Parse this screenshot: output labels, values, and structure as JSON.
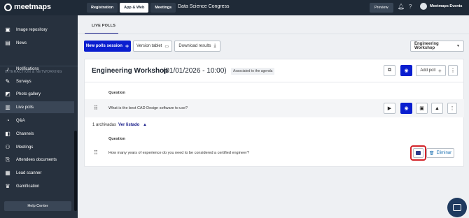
{
  "brand": {
    "name": "meetmaps"
  },
  "topbar": {
    "tabs": [
      {
        "label": "Registration",
        "active": false
      },
      {
        "label": "App & Web",
        "active": true
      },
      {
        "label": "Meetings",
        "active": false
      }
    ],
    "event_name": "Data Science Congress",
    "preview_label": "Preview",
    "user_name": "Meetmaps Events",
    "icons": [
      "bell-icon",
      "help-icon"
    ]
  },
  "sidebar": {
    "items_top": [
      {
        "label": "Image repository",
        "icon": "image-icon"
      },
      {
        "label": "News",
        "icon": "news-icon"
      }
    ],
    "section_label": "INTERACTION & NETWORKING",
    "items": [
      {
        "label": "Notifications",
        "icon": "bell-icon",
        "active": false
      },
      {
        "label": "Surveys",
        "icon": "survey-icon",
        "active": false
      },
      {
        "label": "Photo gallery",
        "icon": "photo-icon",
        "active": false
      },
      {
        "label": "Live polls",
        "icon": "poll-icon",
        "active": true
      },
      {
        "label": "Q&A",
        "icon": "qa-icon",
        "active": false
      },
      {
        "label": "Channels",
        "icon": "channels-icon",
        "active": false
      },
      {
        "label": "Meetings",
        "icon": "meetings-icon",
        "active": false
      },
      {
        "label": "Attendees documents",
        "icon": "document-icon",
        "active": false
      },
      {
        "label": "Lead scanner",
        "icon": "scanner-icon",
        "active": false
      },
      {
        "label": "Gamification",
        "icon": "trophy-icon",
        "active": false
      }
    ],
    "help_label": "Help Center"
  },
  "main": {
    "tab_label": "LIVE POLLS",
    "toolbar": {
      "new_session_label": "New polls session",
      "version_tablet_label": "Version tablet",
      "download_label": "Download results",
      "session_select_value": "Engineering Workshop"
    },
    "session": {
      "title": "Engineering Workshop",
      "date": "(01/01/2026 - 10:00)",
      "agenda_badge": "Associated to the agenda",
      "add_poll_label": "Add poll",
      "question_header": "Question",
      "polls": [
        {
          "question": "What is the best CAD Design software to use?"
        }
      ],
      "archived_count_label": "1 archivadas",
      "ver_listado_label": "Ver listado",
      "archived_question_header": "Question",
      "archived_polls": [
        {
          "question": "How many years of experience do you need to be considered a certified engineer?",
          "delete_label": "Eliminar"
        }
      ]
    }
  },
  "colors": {
    "primary": "#0a1ecf",
    "sidebar_bg": "#27313e",
    "topbar_bg": "#1f2a37",
    "highlight": "#d3242a"
  }
}
